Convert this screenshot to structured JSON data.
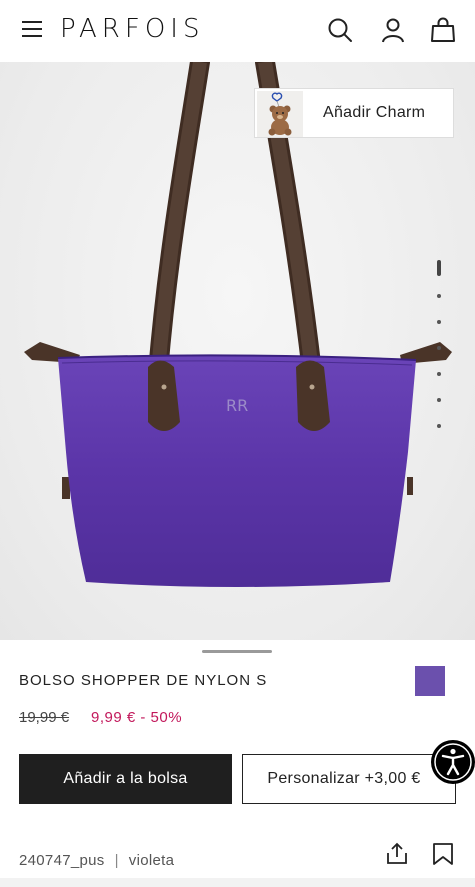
{
  "header": {
    "logo": "PARFOIS",
    "menu_icon": "hamburger-menu-icon",
    "search_icon": "search-icon",
    "account_icon": "user-icon",
    "bag_icon": "shopping-bag-icon"
  },
  "hero": {
    "charm_label": "Añadir Charm",
    "monogram": "RR",
    "image_count": 7,
    "active_image": 1
  },
  "product": {
    "name": "BOLSO SHOPPER DE NYLON S",
    "color_swatch": "#6b50ad",
    "old_price": "19,99 €",
    "new_price": "9,99 € - 50%",
    "add_to_bag": "Añadir a la bolsa",
    "personalize": "Personalizar +3,00 €",
    "reference": "240747_pus",
    "separator": "|",
    "color_name": "violeta"
  },
  "colors": {
    "bag": "#5b35a8",
    "strap": "#4a3428",
    "price_accent": "#c2185b",
    "button_dark": "#1f1f1f"
  }
}
